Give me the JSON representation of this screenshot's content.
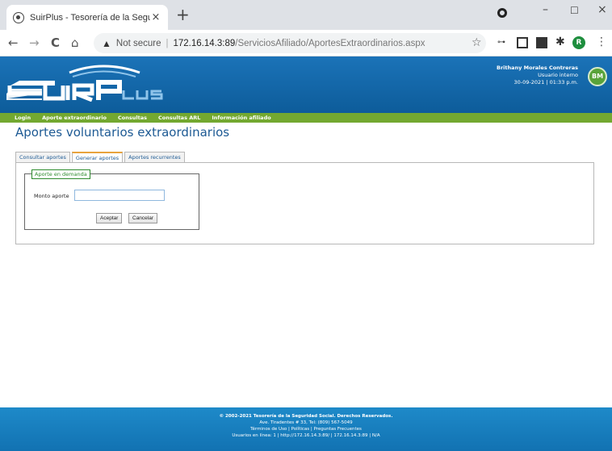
{
  "browser": {
    "tab_title": "SuirPlus - Tesorería de la Seguri",
    "tab_close": "×",
    "new_tab": "+",
    "win_minimize": "–",
    "win_maximize": "☐",
    "win_close": "×",
    "back": "←",
    "forward": "→",
    "reload": "C",
    "home": "⌂",
    "warning_icon": "▲",
    "not_secure": "Not secure",
    "separator": "|",
    "url_host": "172.16.14.3:89",
    "url_path": "/ServiciosAfiliado/AportesExtraordinarios.aspx",
    "star": "☆",
    "ext1": "⊶",
    "ext4": "✱",
    "profile_initial": "R",
    "menu": "⋮"
  },
  "header": {
    "user_name": "Brithany Morales Contreras",
    "user_role": "Usuario interno",
    "datetime": "30-09-2021 | 01:33 p.m.",
    "avatar_initials": "BM"
  },
  "menu": [
    "Login",
    "Aporte extraordinario",
    "Consultas",
    "Consultas ARL",
    "Información afiliado"
  ],
  "page": {
    "title": "Aportes voluntarios extraordinarios",
    "tabs": [
      "Consultar aportes",
      "Generar aportes",
      "Aportes recurrentes"
    ],
    "active_tab": "Generar aportes",
    "fieldset_legend": "Aporte en demanda",
    "amount_label": "Monto aporte",
    "amount_value": "",
    "accept_label": "Aceptar",
    "cancel_label": "Cancelar"
  },
  "footer": {
    "line1": "© 2002-2021 Tesorería de la Seguridad Social. Derechos Reservados.",
    "line2": "Ave. Tiradentes # 33, Tel: (809) 567-5049",
    "line3": "Términos de Uso | Políticas | Preguntas Frecuentes",
    "line4": "Usuarios en línea: 1 | http://172.16.14.3:89/ | 172.16.14.3:89 | N/A"
  },
  "colors": {
    "header_blue": "#1b73b8",
    "menu_green": "#73a830",
    "title_blue": "#1d5a94",
    "footer_blue": "#1e8ac9",
    "active_tab_accent": "#e8a33d"
  }
}
